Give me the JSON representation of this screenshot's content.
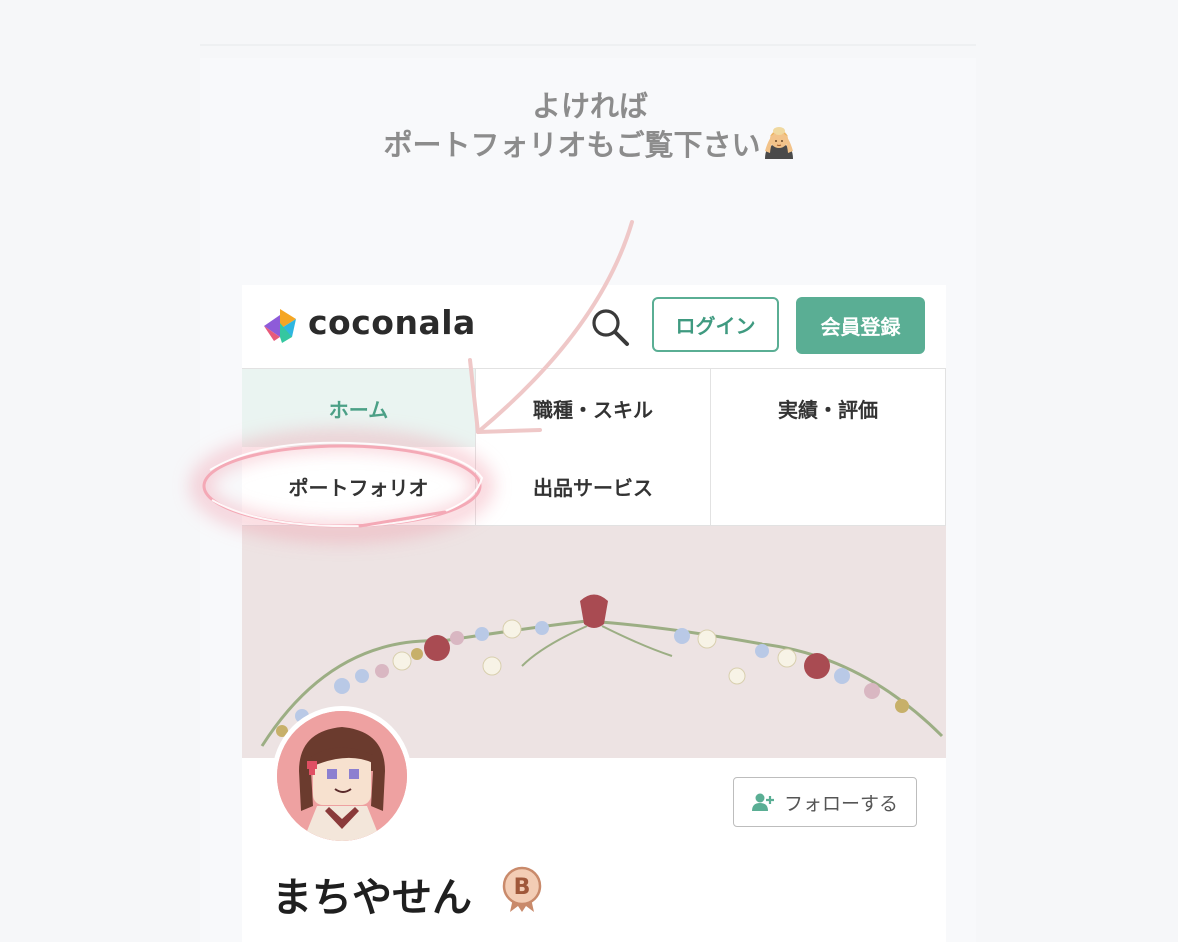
{
  "annotation": {
    "line1": "よければ",
    "line2": "ポートフォリオもご覧下さい",
    "emoji_icon": "person-bowing-emoji",
    "text_color": "#8c8c8c",
    "arrow_color": "#efc8c8",
    "highlight_color": "#ef8e9f"
  },
  "header": {
    "logo_text": "coconala",
    "search_icon": "search-icon",
    "login_label": "ログイン",
    "register_label": "会員登録",
    "accent_color": "#5aae94"
  },
  "tabs": [
    {
      "label": "ホーム",
      "active": true
    },
    {
      "label": "職種・スキル",
      "active": false
    },
    {
      "label": "実績・評価",
      "active": false
    },
    {
      "label": "ポートフォリオ",
      "active": false,
      "highlighted": true
    },
    {
      "label": "出品サービス",
      "active": false
    },
    {
      "label": "",
      "active": false
    }
  ],
  "profile": {
    "follow_label": "フォローする",
    "follow_icon": "user-plus-icon",
    "username": "まちやせん",
    "badge_letter": "B",
    "badge_icon": "rank-b-badge-icon",
    "cover_color": "#ede3e3"
  }
}
